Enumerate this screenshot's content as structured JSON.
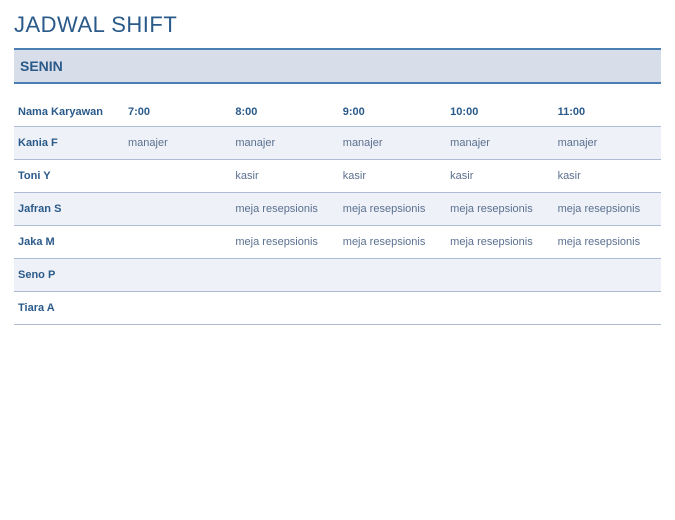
{
  "title": "JADWAL SHIFT",
  "day": "SENIN",
  "headers": {
    "name": "Nama Karyawan",
    "t0": "7:00",
    "t1": "8:00",
    "t2": "9:00",
    "t3": "10:00",
    "t4": "11:00"
  },
  "rows": [
    {
      "name": "Kania F",
      "c": [
        "manajer",
        "manajer",
        "manajer",
        "manajer",
        "manajer"
      ]
    },
    {
      "name": "Toni Y",
      "c": [
        "",
        "kasir",
        "kasir",
        "kasir",
        "kasir"
      ]
    },
    {
      "name": "Jafran S",
      "c": [
        "",
        "meja resepsionis",
        "meja resepsionis",
        "meja resepsionis",
        "meja resepsionis"
      ]
    },
    {
      "name": "Jaka M",
      "c": [
        "",
        "meja resepsionis",
        "meja resepsionis",
        "meja resepsionis",
        "meja resepsionis"
      ]
    },
    {
      "name": "Seno P",
      "c": [
        "",
        "",
        "",
        "",
        ""
      ]
    },
    {
      "name": "Tiara A",
      "c": [
        "",
        "",
        "",
        "",
        ""
      ]
    }
  ]
}
